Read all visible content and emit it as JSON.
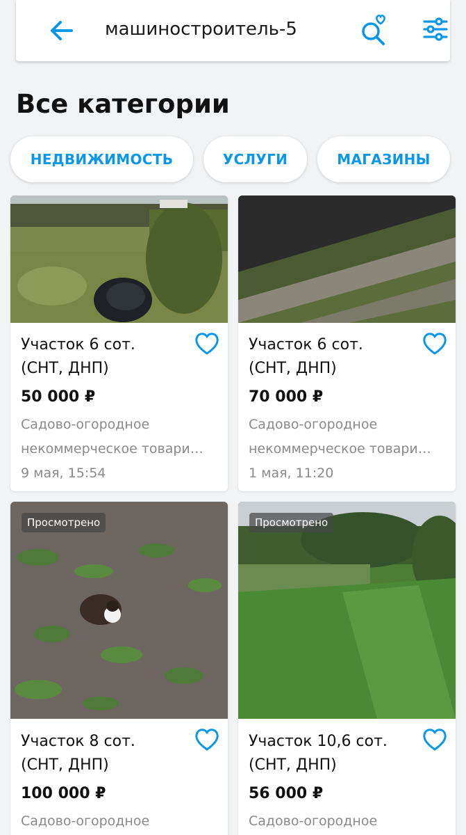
{
  "search": {
    "query": "машиностроитель-5",
    "icons": {
      "back": "arrow-left-icon",
      "saved_search": "search-heart-icon",
      "filters": "sliders-icon"
    }
  },
  "categories": {
    "title": "Все категории",
    "chips": [
      "НЕДВИЖИМОСТЬ",
      "УСЛУГИ",
      "МАГАЗИНЫ"
    ]
  },
  "accent_color": "#0a98e6",
  "listings": [
    {
      "title_line1": "Участок 6 сот.",
      "title_line2": "(СНТ, ДНП)",
      "price": "50 000 ₽",
      "desc_line1": "Садово-огородное",
      "desc_line2": "некоммерческое товари…",
      "date": "9 мая, 15:54",
      "badge": ""
    },
    {
      "title_line1": "Участок 6 сот.",
      "title_line2": "(СНТ, ДНП)",
      "price": "70 000 ₽",
      "desc_line1": "Садово-огородное",
      "desc_line2": "некоммерческое товари…",
      "date": "1 мая, 11:20",
      "badge": ""
    },
    {
      "title_line1": "Участок 8 сот.",
      "title_line2": "(СНТ, ДНП)",
      "price": "100 000 ₽",
      "desc_line1": "Садово-огородное",
      "badge": "Просмотрено"
    },
    {
      "title_line1": "Участок 10,6 сот.",
      "title_line2": "(СНТ, ДНП)",
      "price": "56 000 ₽",
      "desc_line1": "Садово-огородное",
      "badge": "Просмотрено"
    }
  ]
}
